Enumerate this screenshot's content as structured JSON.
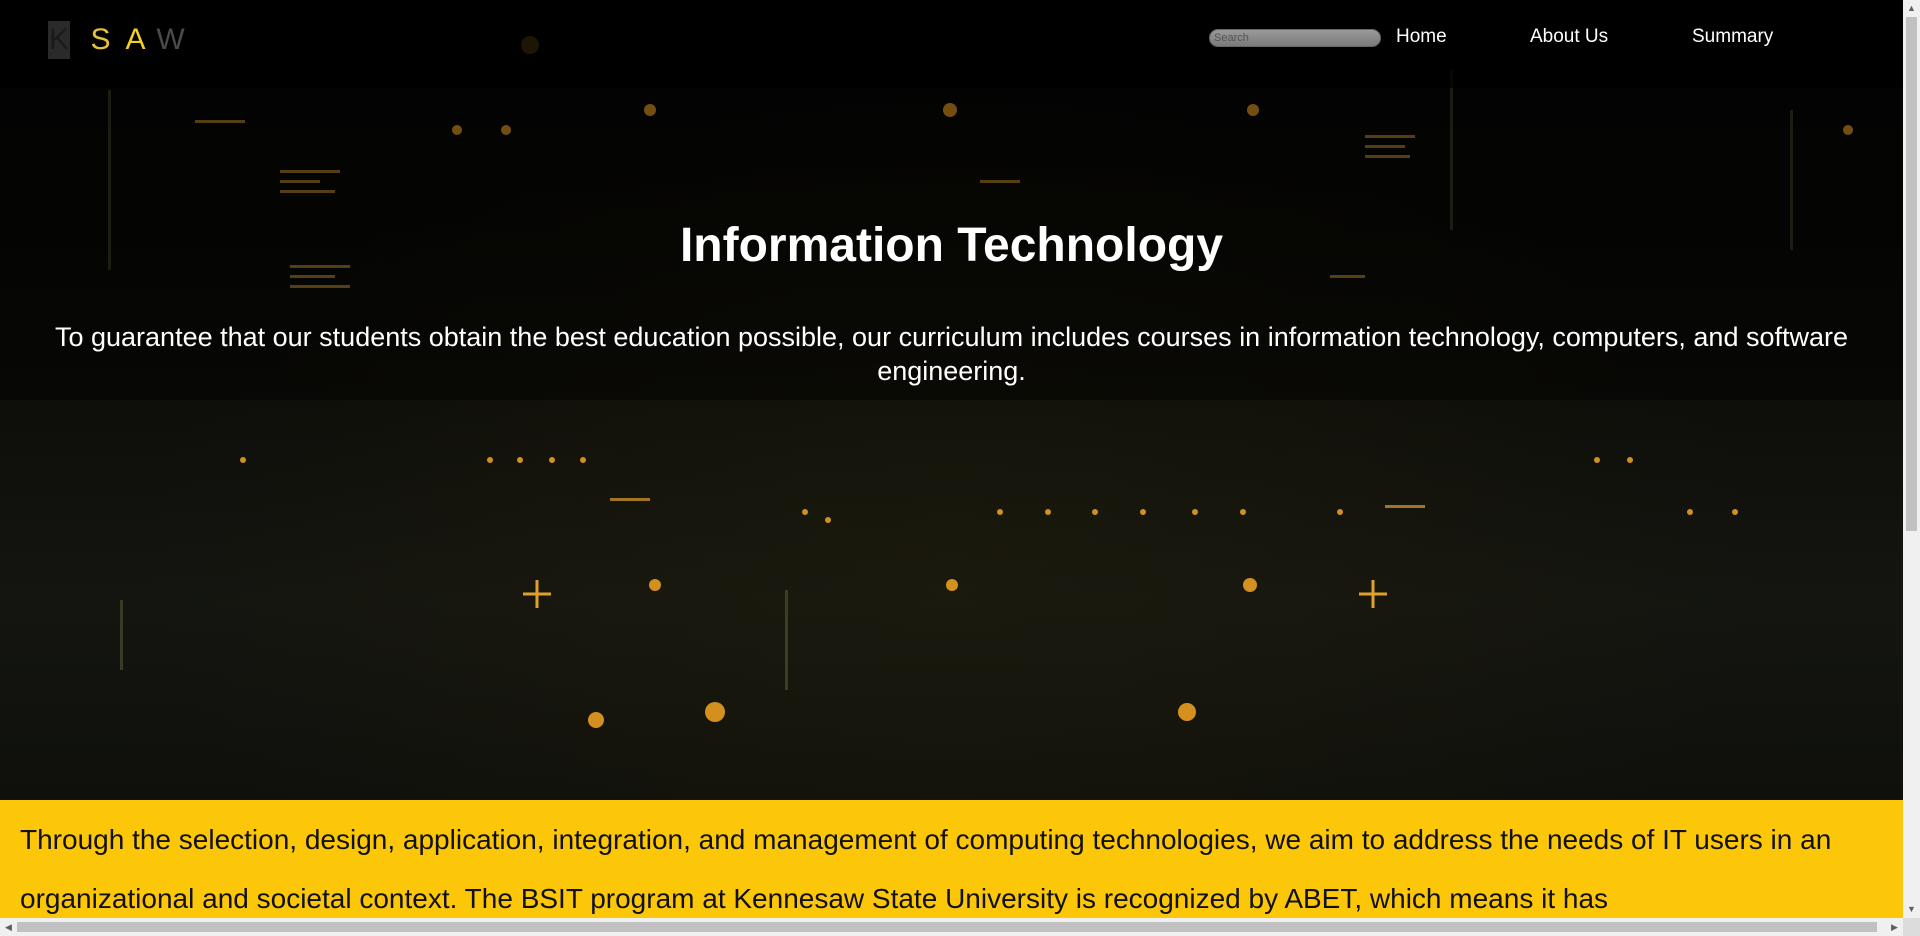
{
  "logo": {
    "letters": [
      "K",
      "S",
      "A",
      "W"
    ]
  },
  "search": {
    "placeholder": "Search"
  },
  "nav": {
    "home": "Home",
    "about": "About Us",
    "summary": "Summary"
  },
  "hero": {
    "title": "Information Technology",
    "subtitle": "To guarantee that our students obtain the best education possible, our curriculum includes courses in information technology, computers, and software engineering."
  },
  "intro": {
    "text": "Through the selection, design, application, integration, and management of computing technologies, we aim to address the needs of IT users in an organizational and societal context. The BSIT program at Kennesaw State University is recognized by ABET, which means it has"
  },
  "colors": {
    "accent": "#fcc708",
    "nav_bg": "#000000",
    "text_light": "#ffffff"
  },
  "icons": {
    "scroll_up": "arrow-up-icon",
    "scroll_down": "arrow-down-icon",
    "scroll_left": "arrow-left-icon",
    "scroll_right": "arrow-right-icon"
  }
}
